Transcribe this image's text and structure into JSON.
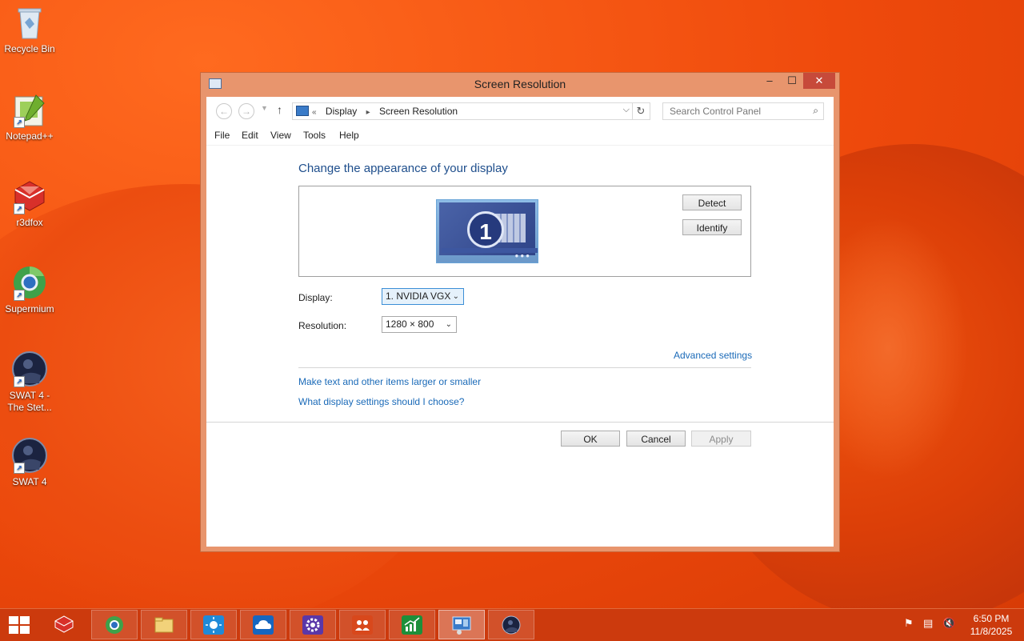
{
  "desktop": {
    "icons": [
      {
        "label": "Recycle Bin",
        "icon": "recycle-bin-icon"
      },
      {
        "label": "Notepad++",
        "icon": "notepad-plus-plus-icon"
      },
      {
        "label": "r3dfox",
        "icon": "r3dfox-icon"
      },
      {
        "label": "Supermium",
        "icon": "supermium-icon"
      },
      {
        "label": "SWAT 4 - The Stet...",
        "icon": "swat4-stetchkov-icon"
      },
      {
        "label": "SWAT 4",
        "icon": "swat4-icon"
      }
    ]
  },
  "window": {
    "title": "Screen Resolution",
    "controls": {
      "minimize": "–",
      "maximize": "☐",
      "close": "✕"
    },
    "address": {
      "overflow": "«",
      "crumbs": [
        "Display",
        "Screen Resolution"
      ]
    },
    "search": {
      "placeholder": "Search Control Panel"
    },
    "menu": [
      "File",
      "Edit",
      "View",
      "Tools",
      "Help"
    ],
    "heading": "Change the appearance of your display",
    "monitor_number": "1",
    "buttons": {
      "detect": "Detect",
      "identify": "Identify",
      "ok": "OK",
      "cancel": "Cancel",
      "apply": "Apply"
    },
    "display_label": "Display:",
    "display_value": "1. NVIDIA VGX",
    "resolution_label": "Resolution:",
    "resolution_value": "1280 × 800",
    "links": {
      "advanced": "Advanced settings",
      "text_size": "Make text and other items larger or smaller",
      "what_settings": "What display settings should I choose?"
    }
  },
  "taskbar": {
    "items": [
      "r3dfox",
      "Supermium",
      "File Explorer",
      "Weather",
      "OneDrive",
      "Settings",
      "People",
      "Finance",
      "Control Panel",
      "SWAT 4"
    ],
    "active_item": "Control Panel",
    "clock": {
      "time": "6:50 PM",
      "date": "11/8/2025"
    }
  },
  "colors": {
    "accent": "#1e4e8c",
    "link": "#1a6ab8",
    "taskbar": "#cc3a0d",
    "close": "#c74a3a"
  }
}
